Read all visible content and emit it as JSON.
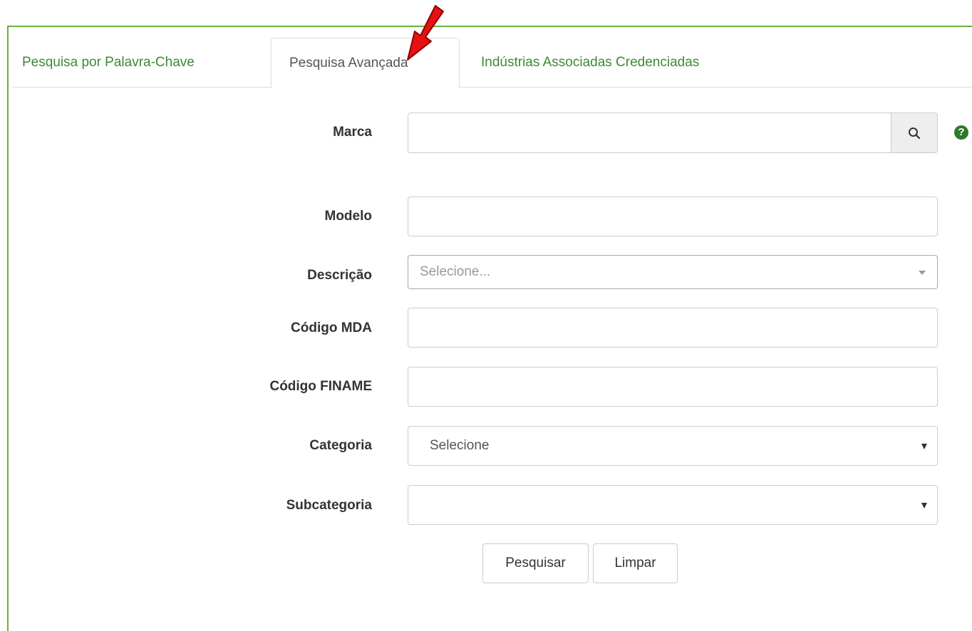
{
  "tabs": {
    "keyword": "Pesquisa por Palavra-Chave",
    "advanced": "Pesquisa Avançada",
    "industries": "Indústrias Associadas Credenciadas"
  },
  "form": {
    "marca_label": "Marca",
    "modelo_label": "Modelo",
    "descricao_label": "Descrição",
    "descricao_placeholder": "Selecione...",
    "codigo_mda_label": "Código MDA",
    "codigo_finame_label": "Código FINAME",
    "categoria_label": "Categoria",
    "categoria_value": "Selecione",
    "subcategoria_label": "Subcategoria",
    "subcategoria_value": "",
    "help_glyph": "?"
  },
  "buttons": {
    "search": "Pesquisar",
    "clear": "Limpar"
  },
  "colors": {
    "accent_green": "#3a8a35",
    "frame_green": "#6aae3f",
    "help_green": "#2c7a2c",
    "annotation_arrow": "#e81010"
  },
  "icons": {
    "search": "magnifier-icon",
    "help": "question-circle-icon",
    "annotation": "red-arrow-icon"
  }
}
